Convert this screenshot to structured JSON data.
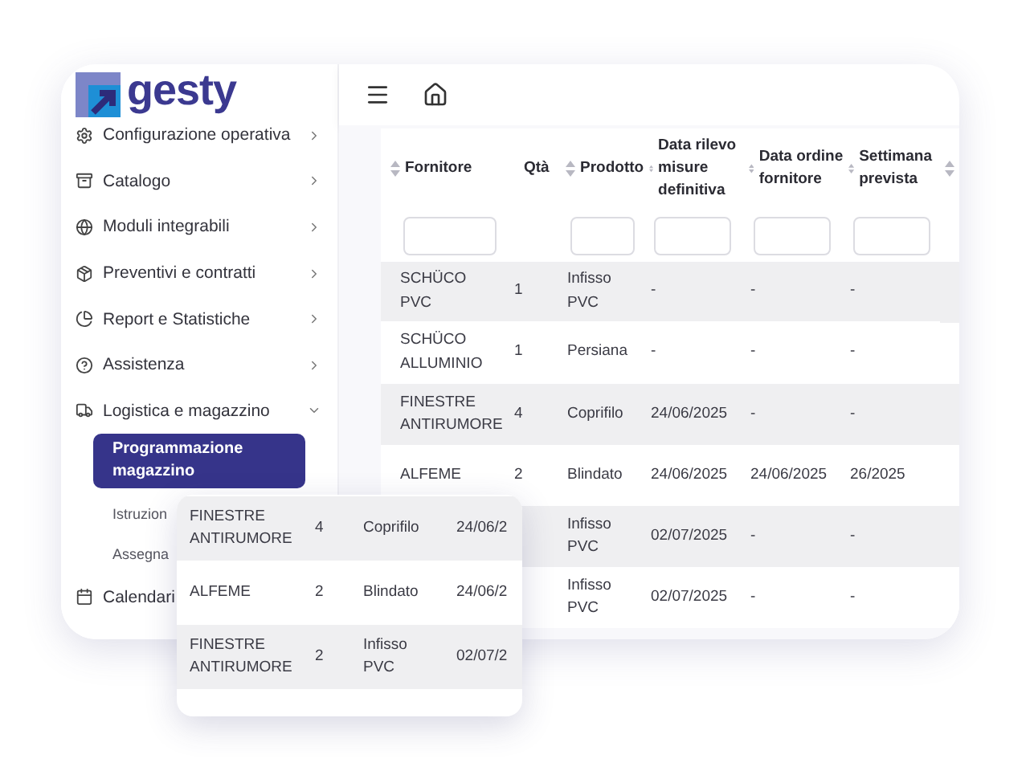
{
  "logo": {
    "text": "gesty"
  },
  "sidebar": {
    "items": [
      {
        "label": "Configurazione operativa",
        "expanded": false
      },
      {
        "label": "Catalogo",
        "expanded": false
      },
      {
        "label": "Moduli integrabili",
        "expanded": false
      },
      {
        "label": "Preventivi e contratti",
        "expanded": false
      },
      {
        "label": "Report e Statistiche",
        "expanded": false
      },
      {
        "label": "Assistenza",
        "expanded": false
      },
      {
        "label": "Logistica e magazzino",
        "expanded": true,
        "children": [
          {
            "label": "Programmazione magazzino",
            "selected": true
          },
          {
            "label": "Istruzion",
            "selected": false
          },
          {
            "label": "Assegna",
            "selected": false
          }
        ]
      },
      {
        "label": "Calendari"
      }
    ]
  },
  "table": {
    "columns": [
      {
        "label": "Fornitore",
        "sortable": true,
        "filter": true
      },
      {
        "label": "Qtà",
        "sortable": false,
        "filter": false
      },
      {
        "label": "Prodotto",
        "sortable": true,
        "filter": true
      },
      {
        "label": "Data rilevo misure definitiva",
        "sortable": true,
        "filter": true
      },
      {
        "label": "Data ordine fornitore",
        "sortable": true,
        "filter": true
      },
      {
        "label": "Settimana prevista",
        "sortable": true,
        "filter": true
      },
      {
        "sortable": true,
        "filter": false
      }
    ],
    "rows": [
      [
        "SCHÜCO PVC",
        "1",
        "Infisso PVC",
        "-",
        "-",
        "-"
      ],
      [
        "SCHÜCO ALLUMINIO",
        "1",
        "Persiana",
        "-",
        "-",
        "-"
      ],
      [
        "FINESTRE ANTIRUMORE",
        "4",
        "Coprifilo",
        "24/06/2025",
        "-",
        "-"
      ],
      [
        "ALFEME",
        "2",
        "Blindato",
        "24/06/2025",
        "24/06/2025",
        "26/2025"
      ],
      [
        null,
        null,
        "Infisso PVC",
        "02/07/2025",
        "-",
        "-"
      ],
      [
        null,
        null,
        "Infisso PVC",
        "02/07/2025",
        "-",
        "-"
      ]
    ]
  },
  "overlay": {
    "rows": [
      [
        "FINESTRE ANTIRUMORE",
        "4",
        "Coprifilo",
        "24/06/2"
      ],
      [
        "ALFEME",
        "2",
        "Blindato",
        "24/06/2"
      ],
      [
        "FINESTRE ANTIRUMORE",
        "2",
        "Infisso PVC",
        "02/07/2"
      ]
    ]
  }
}
